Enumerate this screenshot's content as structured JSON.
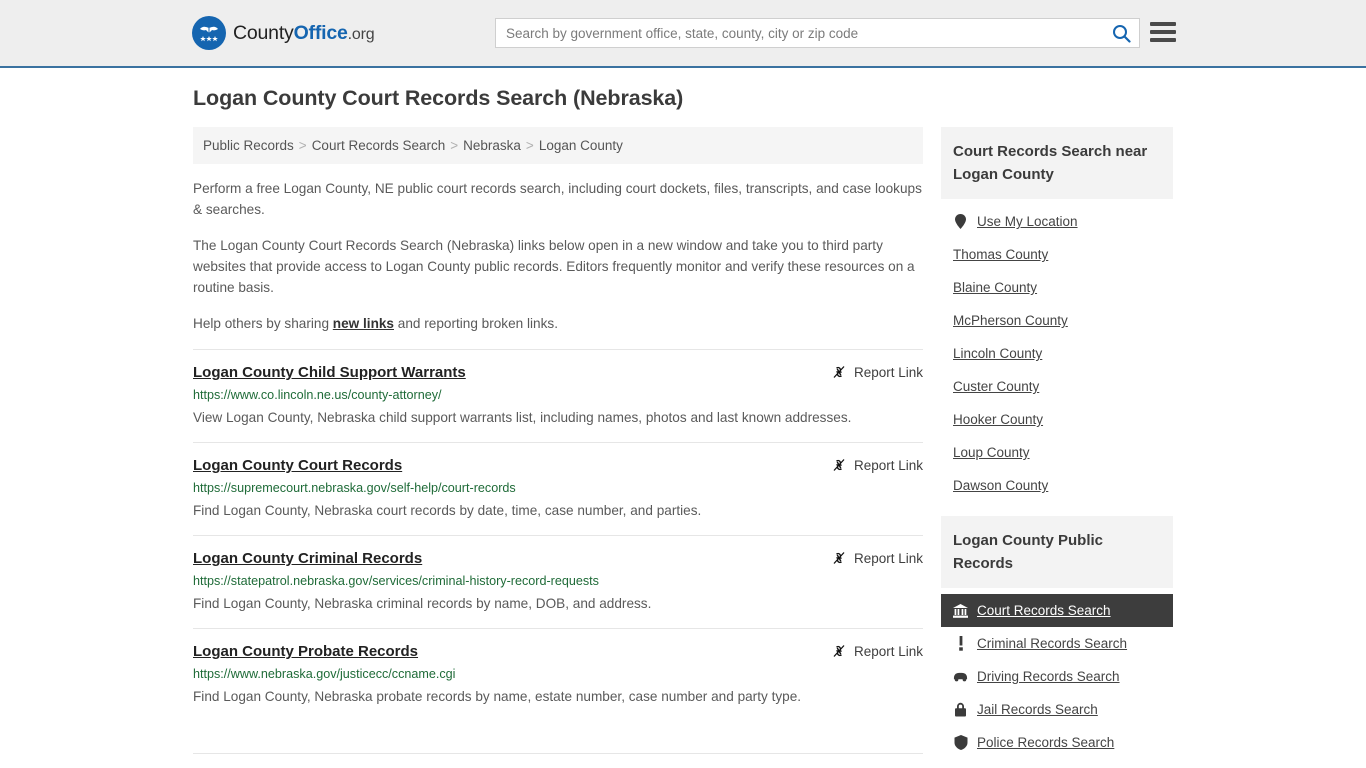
{
  "header": {
    "logo_name": "CountyOffice.org",
    "logo_part1": "County",
    "logo_part2": "Office",
    "logo_part3": ".org",
    "search_placeholder": "Search by government office, state, county, city or zip code",
    "search_value": "",
    "search_icon": "search-icon",
    "menu_icon": "hamburger-menu-icon",
    "accent_color": "#1565b0",
    "border_color": "#3b72a0"
  },
  "page_title": "Logan County Court Records Search (Nebraska)",
  "breadcrumb": {
    "separator": ">",
    "items": [
      {
        "label": "Public Records"
      },
      {
        "label": "Court Records Search"
      },
      {
        "label": "Nebraska"
      },
      {
        "label": "Logan County"
      }
    ]
  },
  "intro": {
    "paragraph_1": "Perform a free Logan County, NE public court records search, including court dockets, files, transcripts, and case lookups & searches.",
    "paragraph_2": "The Logan County Court Records Search (Nebraska) links below open in a new window and take you to third party websites that provide access to Logan County public records. Editors frequently monitor and verify these resources on a routine basis.",
    "share_prefix": "Help others by sharing ",
    "share_link": "new links",
    "share_suffix": " and reporting broken links."
  },
  "results": {
    "report_label": "Report Link",
    "report_icon": "broken-link-icon",
    "items": [
      {
        "title": "Logan County Child Support Warrants",
        "url": "https://www.co.lincoln.ne.us/county-attorney/",
        "description": "View Logan County, Nebraska child support warrants list, including names, photos and last known addresses."
      },
      {
        "title": "Logan County Court Records",
        "url": "https://supremecourt.nebraska.gov/self-help/court-records",
        "description": "Find Logan County, Nebraska court records by date, time, case number, and parties."
      },
      {
        "title": "Logan County Criminal Records",
        "url": "https://statepatrol.nebraska.gov/services/criminal-history-record-requests",
        "description": "Find Logan County, Nebraska criminal records by name, DOB, and address."
      },
      {
        "title": "Logan County Probate Records",
        "url": "https://www.nebraska.gov/justicecc/ccname.cgi",
        "description": "Find Logan County, Nebraska probate records by name, estate number, case number and party type."
      }
    ]
  },
  "sidebar": {
    "nearby": {
      "heading": "Court Records Search near Logan County",
      "items": [
        {
          "label": "Use My Location",
          "icon": "map-pin-icon"
        },
        {
          "label": "Thomas County",
          "icon": ""
        },
        {
          "label": "Blaine County",
          "icon": ""
        },
        {
          "label": "McPherson County",
          "icon": ""
        },
        {
          "label": "Lincoln County",
          "icon": ""
        },
        {
          "label": "Custer County",
          "icon": ""
        },
        {
          "label": "Hooker County",
          "icon": ""
        },
        {
          "label": "Loup County",
          "icon": ""
        },
        {
          "label": "Dawson County",
          "icon": ""
        }
      ]
    },
    "public_records": {
      "heading": "Logan County Public Records",
      "active_background": "#3d3d3d",
      "items": [
        {
          "label": "Court Records Search",
          "icon": "courthouse-icon",
          "active": true
        },
        {
          "label": "Criminal Records Search",
          "icon": "exclamation-icon",
          "active": false
        },
        {
          "label": "Driving Records Search",
          "icon": "car-icon",
          "active": false
        },
        {
          "label": "Jail Records Search",
          "icon": "lock-icon",
          "active": false
        },
        {
          "label": "Police Records Search",
          "icon": "police-badge-icon",
          "active": false
        }
      ]
    }
  }
}
